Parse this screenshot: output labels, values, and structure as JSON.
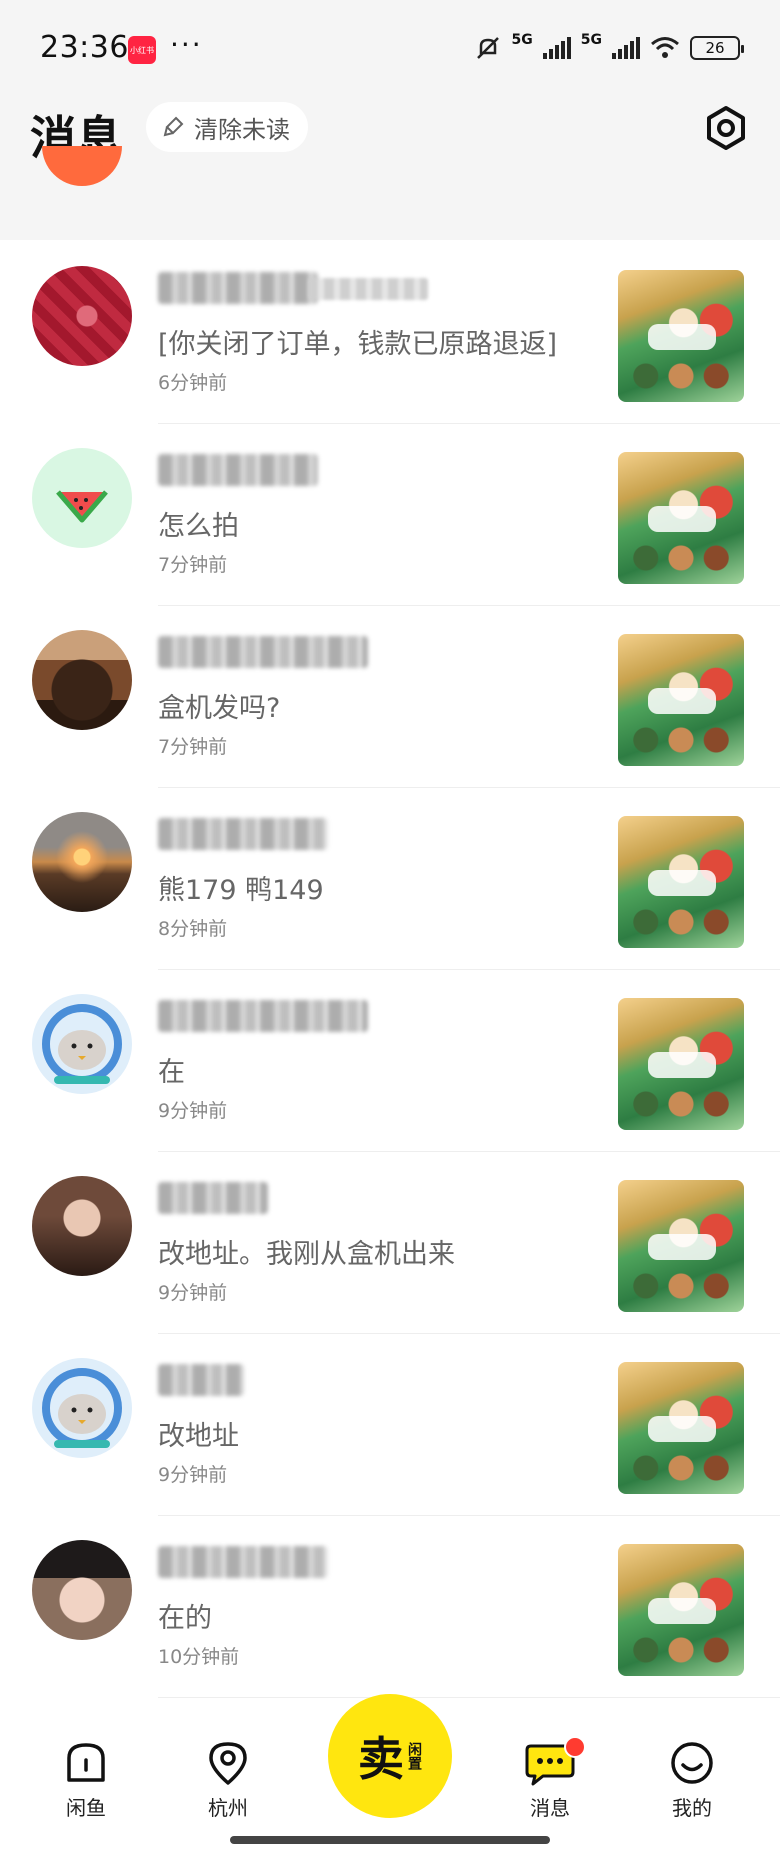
{
  "status_bar": {
    "time": "23:36",
    "app_icon_text": "小红书",
    "more": "···",
    "net1": "5G",
    "net2": "5G",
    "battery": "26"
  },
  "header": {
    "title": "消息",
    "clear_unread": "清除未读"
  },
  "conversations": [
    {
      "message": "[你关闭了订单，钱款已原路退返]",
      "time": "6分钟前",
      "avatar": "red-pattern"
    },
    {
      "message": "怎么拍",
      "time": "7分钟前",
      "avatar": "watermelon"
    },
    {
      "message": "盒机发吗?",
      "time": "7分钟前",
      "avatar": "cake"
    },
    {
      "message": "熊179 鸭149",
      "time": "8分钟前",
      "avatar": "sunset"
    },
    {
      "message": "在",
      "time": "9分钟前",
      "avatar": "seal"
    },
    {
      "message": "改地址。我刚从盒机出来",
      "time": "9分钟前",
      "avatar": "portrait-dark"
    },
    {
      "message": "改地址",
      "time": "9分钟前",
      "avatar": "seal"
    },
    {
      "message": "在的",
      "time": "10分钟前",
      "avatar": "portrait-hat"
    }
  ],
  "nav": {
    "home": "闲鱼",
    "city": "杭州",
    "sell": "卖",
    "sell_sub": "闲置",
    "messages": "消息",
    "me": "我的"
  },
  "colors": {
    "accent": "#ffe60f",
    "badge": "#ff3b30",
    "header_bg": "#f5f5f5"
  }
}
